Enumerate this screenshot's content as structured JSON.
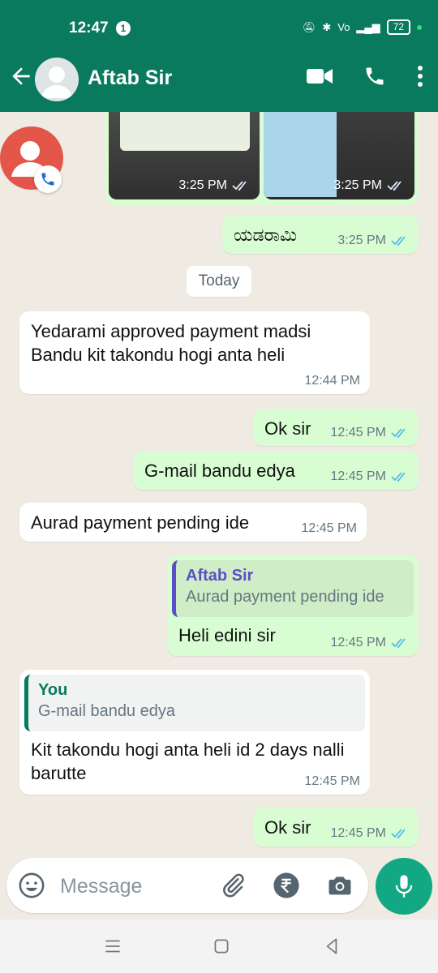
{
  "status": {
    "time": "12:47",
    "notif_count": "1",
    "battery": "72"
  },
  "header": {
    "contact_name": "Aftab Sir"
  },
  "images": {
    "time1": "3:25 PM",
    "time2": "3:25 PM"
  },
  "messages": [
    {
      "text": "ಯಡರಾಮಿ",
      "time": "3:25 PM"
    },
    {
      "text": "Yedarami approved payment madsi Bandu kit takondu hogi anta heli",
      "time": "12:44 PM"
    },
    {
      "text": "Ok sir",
      "time": "12:45 PM"
    },
    {
      "text": "G-mail bandu edya",
      "time": "12:45 PM"
    },
    {
      "text": "Aurad payment pending ide",
      "time": "12:45 PM"
    },
    {
      "quote_name": "Aftab Sir",
      "quote_text": "Aurad payment pending ide",
      "text": "Heli edini sir",
      "time": "12:45 PM"
    },
    {
      "quote_name": "You",
      "quote_text": "G-mail bandu edya",
      "text": "Kit takondu hogi anta heli id 2 days nalli barutte",
      "time": "12:45 PM"
    },
    {
      "text": "Ok sir",
      "time": "12:45 PM"
    }
  ],
  "day_divider": "Today",
  "composer": {
    "placeholder": "Message"
  },
  "colors": {
    "header": "#0a7a5e",
    "outgoing": "#d9fdd3",
    "incoming": "#ffffff",
    "accent": "#12a884",
    "ticks": "#53bdeb"
  },
  "icons": [
    "back-arrow-icon",
    "video-call-icon",
    "phone-icon",
    "more-icon",
    "emoji-icon",
    "attach-icon",
    "rupee-icon",
    "camera-icon",
    "mic-icon"
  ]
}
